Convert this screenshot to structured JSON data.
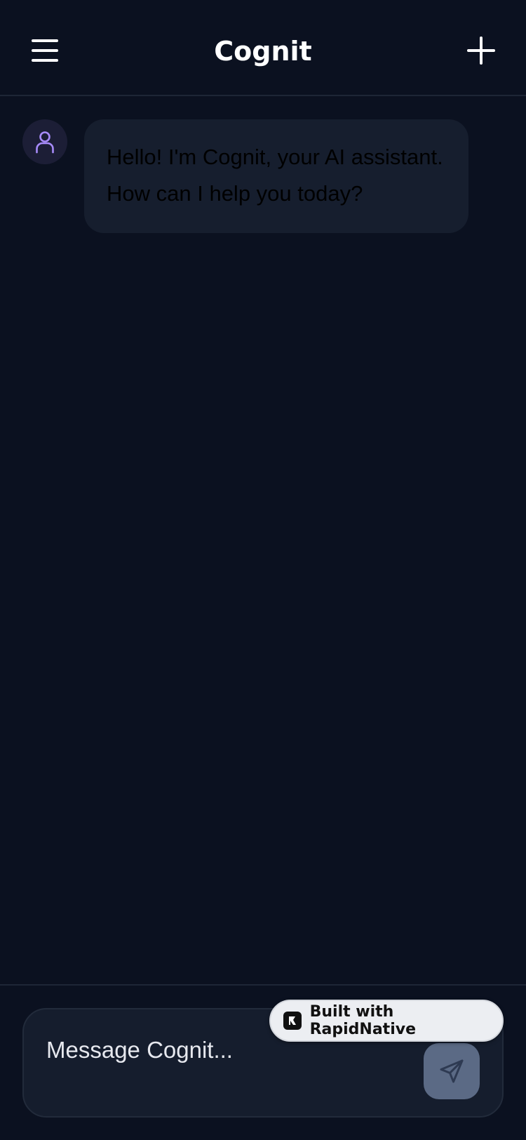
{
  "header": {
    "title": "Cognit",
    "menu_icon": "hamburger-menu-icon",
    "new_chat_icon": "plus-icon"
  },
  "messages": [
    {
      "role": "assistant",
      "avatar_icon": "user-icon",
      "text": "Hello! I'm Cognit, your AI assistant. How can I help you today?"
    }
  ],
  "composer": {
    "placeholder": "Message Cognit...",
    "value": "",
    "send_icon": "send-icon"
  },
  "badge": {
    "label": "Built with RapidNative",
    "logo_icon": "rapidnative-logo-icon"
  },
  "colors": {
    "background": "#0b1120",
    "bubble": "#161e2e",
    "avatar_bg": "#1c1e36",
    "avatar_icon": "#a78bfa",
    "send_button": "#5b6a85"
  }
}
